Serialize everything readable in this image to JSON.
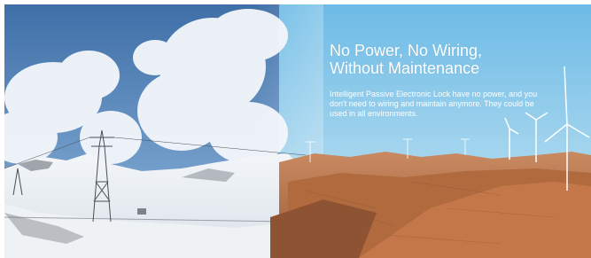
{
  "hero": {
    "title": "No Power, No Wiring,\nWithout Maintenance",
    "description": "Intelligent Passive Electronic Lock have no power, and you don't need to wiring and maintain anymore. They could be used in all environments."
  }
}
